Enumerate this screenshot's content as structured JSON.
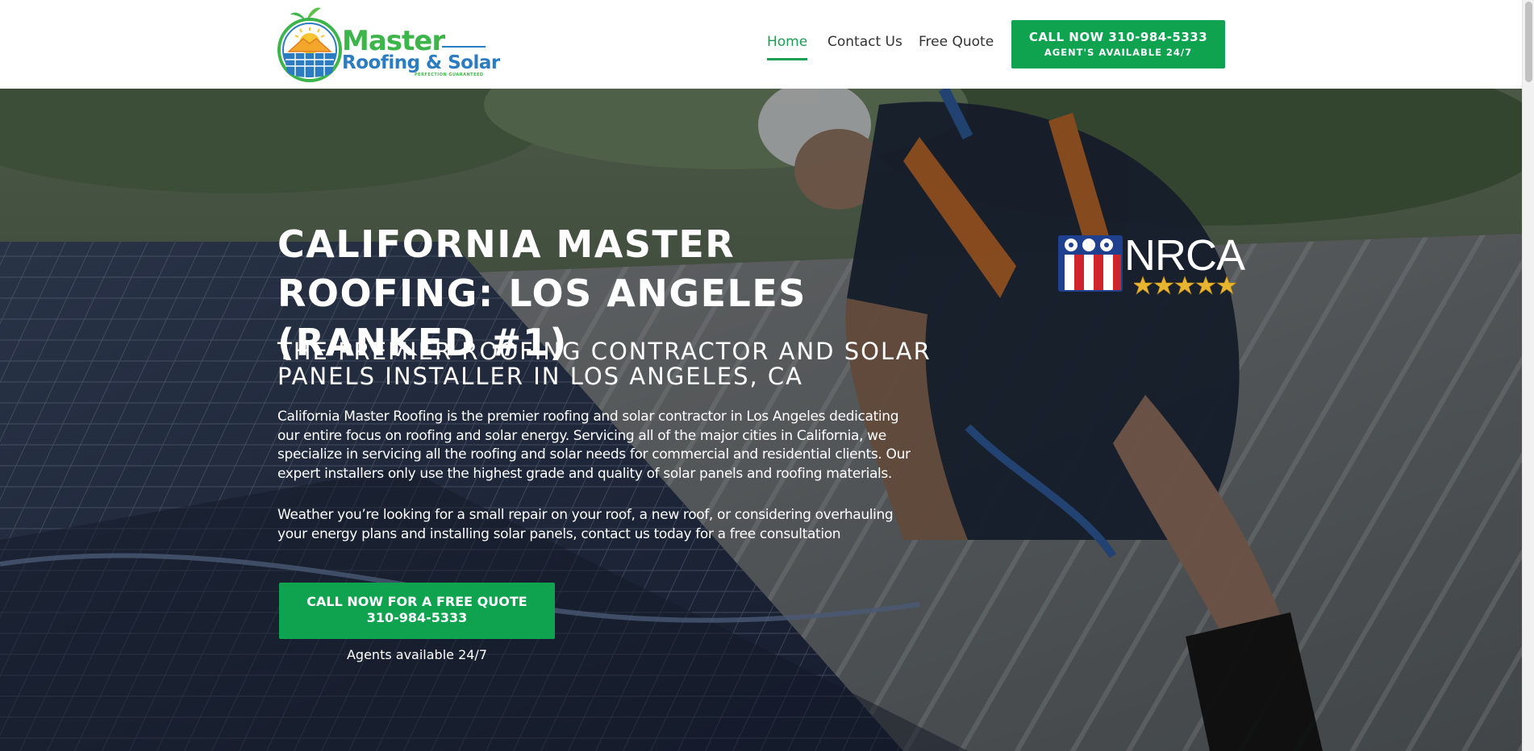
{
  "header": {
    "logo": {
      "line1": "Master",
      "line2": "Roofing & Solar",
      "tagline": "PERFECTION GUARANTEED"
    },
    "nav": [
      {
        "label": "Home",
        "active": true
      },
      {
        "label": "Contact Us",
        "active": false
      },
      {
        "label": "Free Quote",
        "active": false
      }
    ],
    "call_button": {
      "line1": "CALL NOW 310-984-5333",
      "line2": "AGENT'S AVAILABLE 24/7"
    }
  },
  "hero": {
    "title": "CALIFORNIA MASTER ROOFING: LOS ANGELES (RANKED #1)",
    "subtitle": "THE PREMIER ROOFING CONTRACTOR AND SOLAR PANELS INSTALLER IN LOS ANGELES, CA",
    "paragraph1": "California Master Roofing is the premier roofing and solar contractor in Los Angeles dedicating our entire focus on roofing and solar energy. Servicing all of the major cities in California, we specialize in servicing all the roofing and solar needs for commercial and residential clients. Our expert installers only use the highest grade and quality of solar panels and roofing materials.",
    "paragraph2": "Weather you’re looking for a small repair on your roof, a new roof, or considering overhauling your energy plans and installing solar panels, contact us today for a free consultation",
    "cta": {
      "line1": "CALL NOW FOR A FREE QUOTE",
      "line2": "310-984-5333"
    },
    "cta_note": "Agents available 24/7",
    "badge": {
      "text": "NRCA",
      "stars": 5
    }
  },
  "colors": {
    "brand_green": "#0fa350",
    "logo_green": "#3cb54a",
    "logo_blue": "#2c7cc1",
    "nav_active": "#1a9e52",
    "nav_text": "#333333"
  },
  "icons": [
    "logo-sun-leaf-icon",
    "solar-panel-icon",
    "nrca-flag-icon",
    "star-icon"
  ]
}
